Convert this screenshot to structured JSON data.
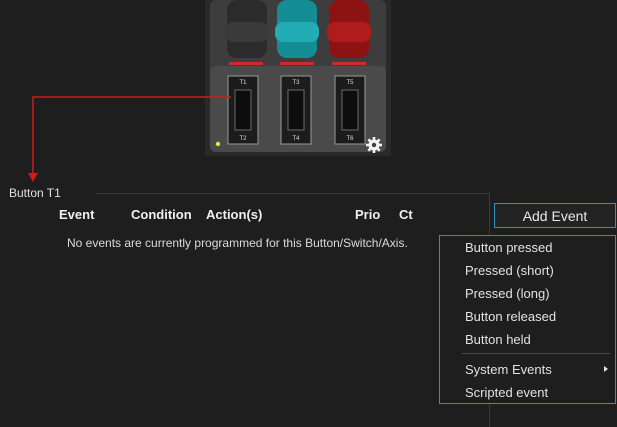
{
  "group": {
    "title": "Button T1",
    "columns": [
      "Event",
      "Condition",
      "Action(s)",
      "Prio",
      "Ct"
    ],
    "empty_message": "No events are currently programmed for this Button/Switch/Axis."
  },
  "add_event_label": "Add Event",
  "menu": {
    "items": [
      "Button pressed",
      "Pressed (short)",
      "Pressed (long)",
      "Button released",
      "Button held"
    ],
    "extra_items": [
      "System Events",
      "Scripted event"
    ]
  },
  "device": {
    "switch_labels_top": [
      "T1",
      "T3",
      "T5"
    ],
    "switch_labels_bottom": [
      "T2",
      "T4",
      "T6"
    ],
    "colors": {
      "lever1": "#2a2a2a",
      "lever2": "#1c9aa2",
      "lever3": "#a01818",
      "indicator": "#d12a2a",
      "arrow": "#d11a1a",
      "led": "#e3e840"
    }
  },
  "accent": "#2f8fc2"
}
